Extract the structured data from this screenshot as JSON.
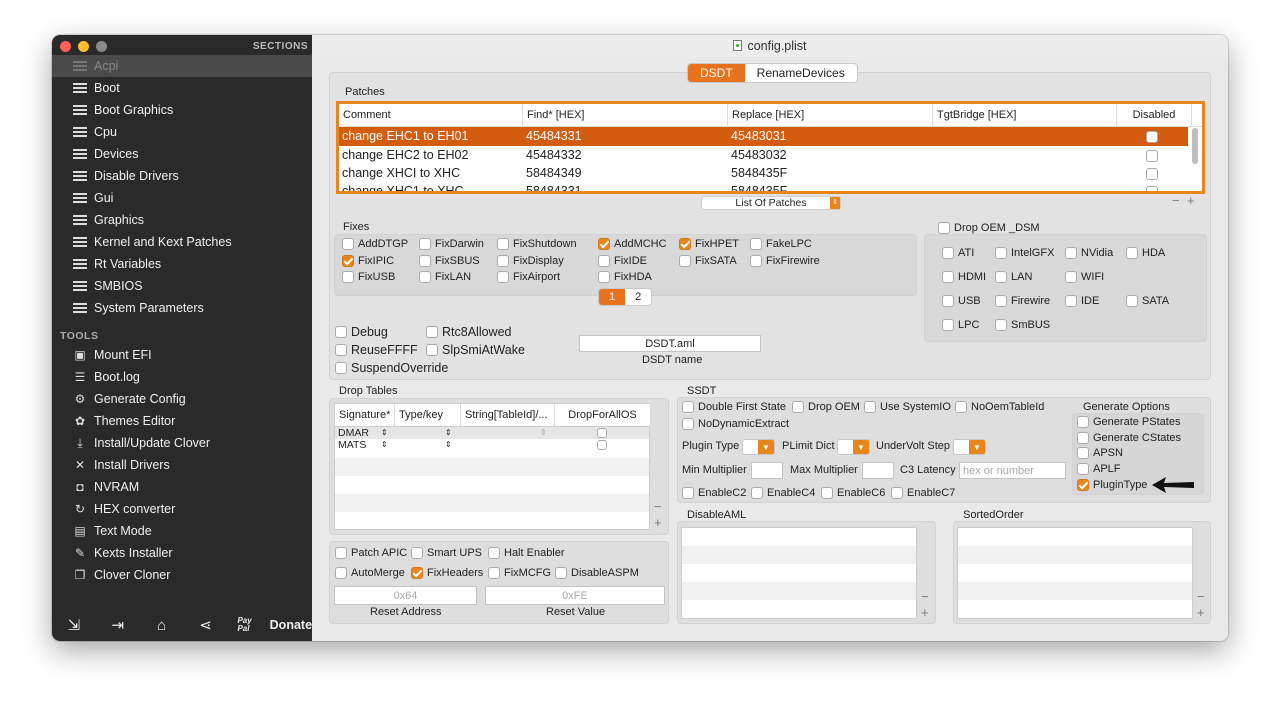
{
  "window": {
    "title": "config.plist"
  },
  "sidebar": {
    "sections_title": "SECTIONS",
    "items": [
      "Acpi",
      "Boot",
      "Boot Graphics",
      "Cpu",
      "Devices",
      "Disable Drivers",
      "Gui",
      "Graphics",
      "Kernel and Kext Patches",
      "Rt Variables",
      "SMBIOS",
      "System Parameters"
    ],
    "tools_title": "TOOLS",
    "tools": [
      {
        "label": "Mount EFI",
        "icon": "disk-icon"
      },
      {
        "label": "Boot.log",
        "icon": "log-icon"
      },
      {
        "label": "Generate Config",
        "icon": "gears-icon"
      },
      {
        "label": "Themes Editor",
        "icon": "palette-icon"
      },
      {
        "label": "Install/Update Clover",
        "icon": "download-icon"
      },
      {
        "label": "Install Drivers",
        "icon": "tools-icon"
      },
      {
        "label": "NVRAM",
        "icon": "chip-icon"
      },
      {
        "label": "HEX converter",
        "icon": "refresh-icon"
      },
      {
        "label": "Text Mode",
        "icon": "text-icon"
      },
      {
        "label": "Kexts Installer",
        "icon": "vacuum-icon"
      },
      {
        "label": "Clover Cloner",
        "icon": "clone-icon"
      }
    ],
    "donate": "Donate",
    "paypal": "Pay Pal"
  },
  "tabs": [
    "DSDT",
    "RenameDevices"
  ],
  "patches": {
    "label": "Patches",
    "columns": [
      "Comment",
      "Find* [HEX]",
      "Replace [HEX]",
      "TgtBridge [HEX]",
      "Disabled"
    ],
    "rows": [
      {
        "comment": "change EHC1 to EH01",
        "find": "45484331",
        "replace": "45483031"
      },
      {
        "comment": "change EHC2 to EH02",
        "find": "45484332",
        "replace": "45483032"
      },
      {
        "comment": "change XHCI to XHC",
        "find": "58484349",
        "replace": "5848435F"
      },
      {
        "comment": "change XHC1 to XHC",
        "find": "58484331",
        "replace": "5848435F"
      }
    ],
    "list_button": "List Of Patches"
  },
  "fixes": {
    "label": "Fixes",
    "items": [
      {
        "label": "AddDTGP",
        "on": false
      },
      {
        "label": "FixDarwin",
        "on": false
      },
      {
        "label": "FixShutdown",
        "on": false
      },
      {
        "label": "AddMCHC",
        "on": true
      },
      {
        "label": "FixHPET",
        "on": true
      },
      {
        "label": "FakeLPC",
        "on": false
      },
      {
        "label": "FixIPIC",
        "on": true
      },
      {
        "label": "FixSBUS",
        "on": false
      },
      {
        "label": "FixDisplay",
        "on": false
      },
      {
        "label": "FixIDE",
        "on": false
      },
      {
        "label": "FixSATA",
        "on": false
      },
      {
        "label": "FixFirewire",
        "on": false
      },
      {
        "label": "FixUSB",
        "on": false
      },
      {
        "label": "FixLAN",
        "on": false
      },
      {
        "label": "FixAirport",
        "on": false
      },
      {
        "label": "FixHDA",
        "on": false
      }
    ],
    "pages": [
      "1",
      "2"
    ]
  },
  "drop_oem_dsm": {
    "label": "Drop OEM _DSM",
    "items": [
      "ATI",
      "IntelGFX",
      "NVidia",
      "HDA",
      "HDMI",
      "LAN",
      "WIFI",
      "USB",
      "Firewire",
      "IDE",
      "SATA",
      "LPC",
      "SmBUS"
    ]
  },
  "misc": {
    "debug": "Debug",
    "rtc8": "Rtc8Allowed",
    "reuse": "ReuseFFFF",
    "slpsmi": "SlpSmiAtWake",
    "suspend": "SuspendOverride",
    "dsdt_value": "DSDT.aml",
    "dsdt_name": "DSDT name"
  },
  "drop_tables": {
    "label": "Drop Tables",
    "columns": [
      "Signature*",
      "Type/key",
      "String[TableId]/...",
      "DropForAllOS"
    ],
    "rows": [
      "DMAR",
      "MATS"
    ]
  },
  "ssdt": {
    "label": "SSDT",
    "double_first": "Double First State",
    "drop_oem": "Drop OEM",
    "use_systemio": "Use SystemIO",
    "no_oem": "NoOemTableId",
    "no_dynamic": "NoDynamicExtract",
    "plugin_type": "Plugin Type",
    "plimit": "PLimit Dict",
    "undervolt": "UnderVolt Step",
    "min_mult": "Min Multiplier",
    "max_mult": "Max Multiplier",
    "c3": "C3 Latency",
    "c3_placeholder": "hex or number",
    "enable_c": [
      "EnableC2",
      "EnableC4",
      "EnableC6",
      "EnableC7"
    ],
    "gen_label": "Generate Options",
    "gen": [
      {
        "label": "Generate PStates",
        "on": false
      },
      {
        "label": "Generate CStates",
        "on": false
      },
      {
        "label": "APSN",
        "on": false
      },
      {
        "label": "APLF",
        "on": false
      },
      {
        "label": "PluginType",
        "on": true
      }
    ]
  },
  "bottom": {
    "patch_apic": "Patch APIC",
    "smart_ups": "Smart UPS",
    "halt": "Halt Enabler",
    "automerge": "AutoMerge",
    "fixheaders": "FixHeaders",
    "fixmcfg": "FixMCFG",
    "disableaspm": "DisableASPM",
    "reset_addr_ph": "0x64",
    "reset_addr": "Reset Address",
    "reset_val_ph": "0xFE",
    "reset_val": "Reset Value"
  },
  "disable_aml": "DisableAML",
  "sorted_order": "SortedOrder",
  "colors": {
    "accent": "#e8731c",
    "sidebar": "#2a2a2a"
  }
}
